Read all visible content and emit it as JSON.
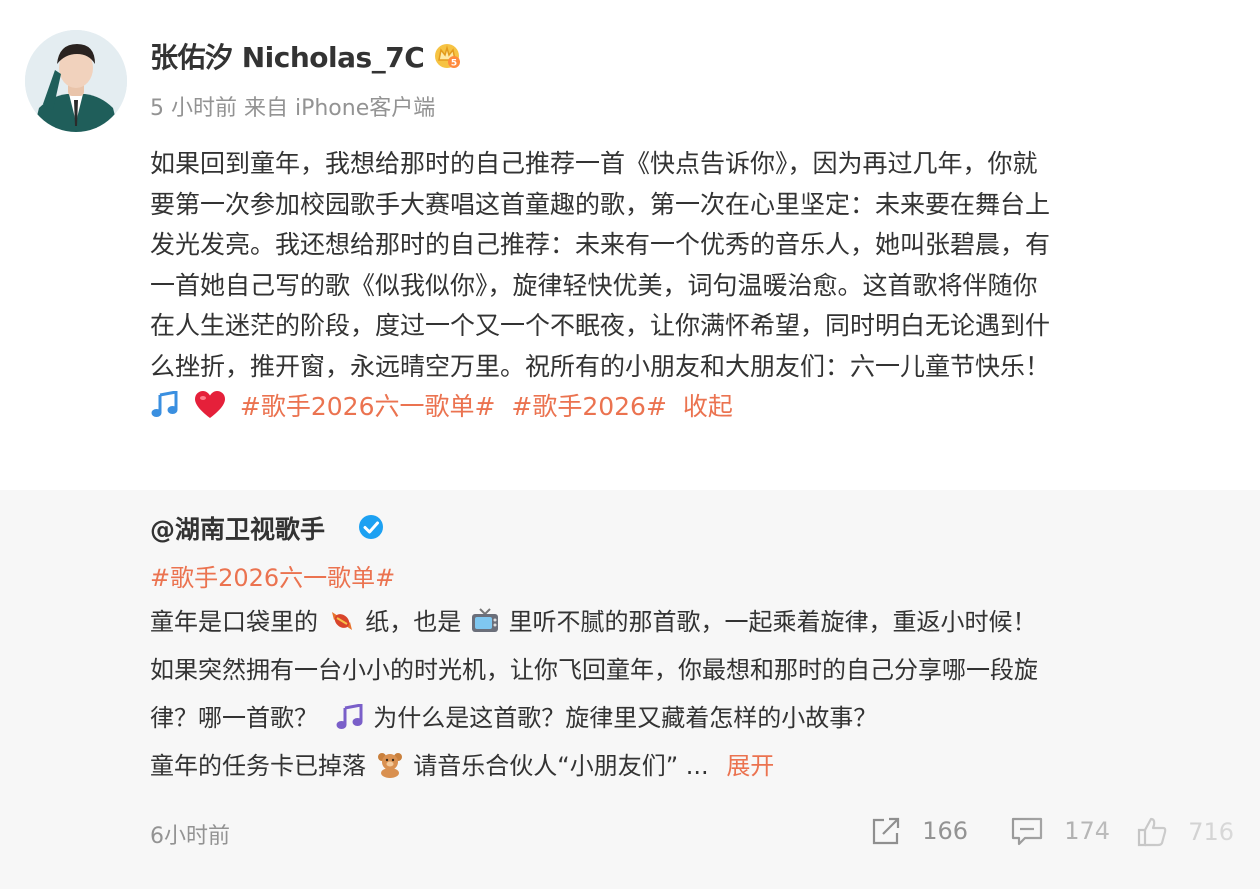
{
  "post": {
    "author": "张佑汐 Nicholas_7C",
    "meta": "5 小时前  来自 iPhone客户端",
    "lines": [
      "如果回到童年，我想给那时的自己推荐一首《快点告诉你》，因为再过几年，你就",
      "要第一次参加校园歌手大赛唱这首童趣的歌，第一次在心里坚定：未来要在舞台上",
      "发光发亮。我还想给那时的自己推荐：未来有一个优秀的音乐人，她叫张碧晨，有",
      "一首她自己写的歌《似我似你》，旋律轻快优美，词句温暖治愈。这首歌将伴随你",
      "在人生迷茫的阶段，度过一个又一个不眠夜，让你满怀希望，同时明白无论遇到什",
      "么挫折，推开窗，永远晴空万里。祝所有的小朋友和大朋友们：六一儿童节快乐！"
    ],
    "tags": [
      "#歌手2026六一歌单#",
      "#歌手2026#"
    ],
    "collapse_label": "收起"
  },
  "repost": {
    "author": "@湖南卫视歌手",
    "tag": "#歌手2026六一歌单#",
    "line1a": "童年是口袋里的",
    "line1b": "纸，也是",
    "line1c": "里听不腻的那首歌，一起乘着旋律，重返小时候！",
    "line2": "如果突然拥有一台小小的时光机，让你飞回童年，你最想和那时的自己分享哪一段旋",
    "line3a": "律？哪一首歌？",
    "line3b": "为什么是这首歌？旋律里又藏着怎样的小故事？",
    "line4a": "童年的任务卡已掉落",
    "line4b": "请音乐合伙人“小朋友们” ...",
    "expand_label": "展开",
    "time": "6小时前",
    "counts": {
      "repost": "166",
      "comment": "174",
      "like": "716"
    }
  },
  "icons": [
    "crown-icon",
    "verified-icon",
    "music-note-icon",
    "heart-icon",
    "candy-icon",
    "tv-icon",
    "teddy-bear-icon",
    "repost-icon",
    "comment-icon",
    "like-icon"
  ],
  "colors": {
    "accent": "#eb7350",
    "verified": "#1da1f2",
    "muted": "#939393",
    "repost_bg": "#f7f7f7"
  }
}
